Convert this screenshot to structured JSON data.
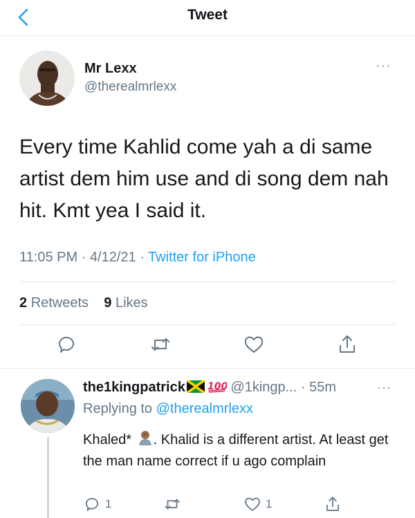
{
  "header": {
    "title": "Tweet"
  },
  "tweet": {
    "author_name": "Mr Lexx",
    "author_handle": "@therealmrlexx",
    "text": "Every time Kahlid come yah a di same artist dem him use and di song dem nah hit. Kmt yea I said it.",
    "time": "11:05 PM",
    "date": "4/12/21",
    "source": "Twitter for iPhone",
    "retweets_count": "2",
    "retweets_label": "Retweets",
    "likes_count": "9",
    "likes_label": "Likes",
    "more": "···"
  },
  "reply": {
    "author_name": "the1kingpatrick",
    "author_handle": "@1kingp...",
    "age": "55m",
    "replying_prefix": "Replying to",
    "replying_handle": "@therealmrlexx",
    "text_part1": "Khaled*",
    "text_part2": ". Khalid is a different artist. At least get the man name correct if u ago complain",
    "reply_count": "1",
    "like_count": "1",
    "more": "···"
  },
  "colors": {
    "accent": "#1da1f2",
    "muted": "#657786",
    "text": "#14171a"
  },
  "icons": [
    "back-chevron-icon",
    "reply-icon",
    "retweet-icon",
    "like-icon",
    "share-icon",
    "jamaica-flag-icon",
    "hundred-icon",
    "facepalm-emoji-icon"
  ]
}
